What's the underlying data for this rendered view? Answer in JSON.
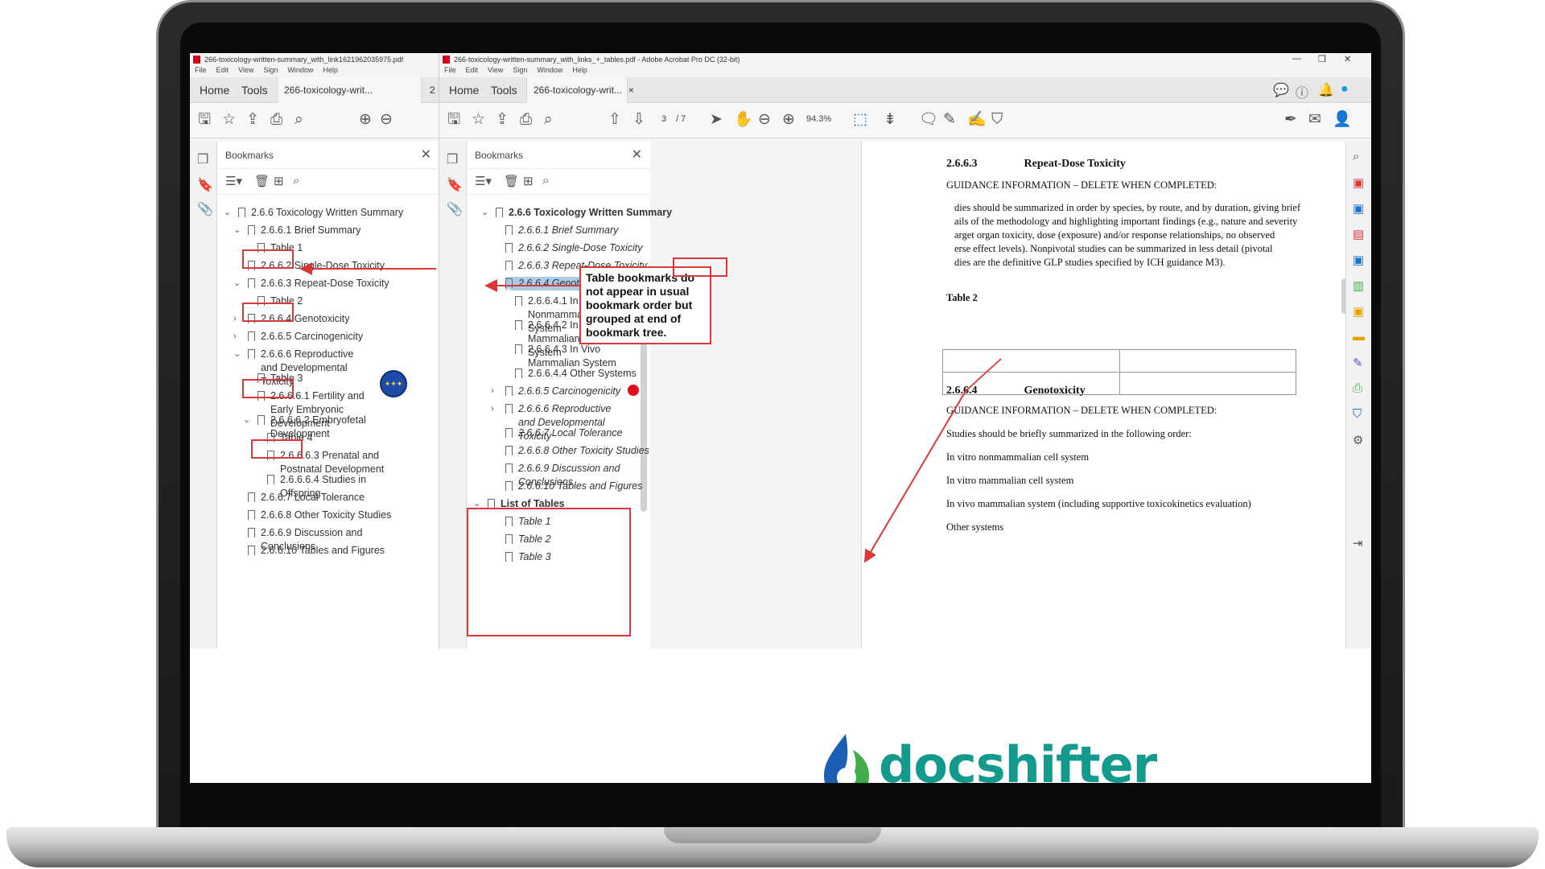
{
  "left_window": {
    "title": "266-toxicology-written-summary_with_link1621962035975.pdf",
    "menu": [
      "File",
      "Edit",
      "View",
      "Sign",
      "Window",
      "Help"
    ],
    "tabs": {
      "home": "Home",
      "tools": "Tools",
      "doc": "266-toxicology-writ...",
      "overflow": "2"
    },
    "panel_title": "Bookmarks",
    "bookmarks": [
      "2.6.6 Toxicology Written Summary",
      "2.6.6.1 Brief Summary",
      "Table 1",
      "2.6.6.2 Single-Dose Toxicity",
      "2.6.6.3 Repeat-Dose Toxicity",
      "Table 2",
      "2.6.6.4 Genotoxicity",
      "2.6.6.5 Carcinogenicity",
      "2.6.6.6 Reproductive and Developmental Toxicity",
      "Table 3",
      "2.6.6.6.1 Fertility and Early Embryonic Development",
      "2.6.6.6.2 Embryofetal Development",
      "Table 4",
      "2.6.6.6.3 Prenatal and Postnatal Development",
      "2.6.6.6.4 Studies in Offspring",
      "2.6.6.7 Local Tolerance",
      "2.6.6.8 Other Toxicity Studies",
      "2.6.6.9 Discussion and Conclusions",
      "2.6.6.10 Tables and Figures"
    ]
  },
  "right_window": {
    "title": "266-toxicology-written-summary_with_links_+_tables.pdf - Adobe Acrobat Pro DC (32-bit)",
    "menu": [
      "File",
      "Edit",
      "View",
      "Sign",
      "Window",
      "Help"
    ],
    "tabs": {
      "home": "Home",
      "tools": "Tools",
      "doc": "266-toxicology-writ...",
      "close": "×"
    },
    "page_current": "3",
    "page_total": "/ 7",
    "zoom": "94.3%",
    "panel_title": "Bookmarks",
    "bookmarks": [
      "2.6.6 Toxicology Written Summary",
      "2.6.6.1 Brief Summary",
      "2.6.6.2 Single-Dose Toxicity",
      "2.6.6.3 Repeat-Dose Toxicity",
      "2.6.6.4 Genotoxicity",
      "2.6.6.4.1 In Vitro Nonmammalian Cell System",
      "2.6.6.4.2 In Vitro Mammalian Cell System",
      "2.6.6.4.3 In Vivo Mammalian System",
      "2.6.6.4.4 Other Systems",
      "2.6.6.5 Carcinogenicity",
      "2.6.6.6 Reproductive and Developmental Toxicity",
      "2.6.6.7 Local Tolerance",
      "2.6.6.8 Other Toxicity Studies",
      "2.6.6.9 Discussion and Conclusions",
      "2.6.6.10 Tables and Figures",
      "List of Tables",
      "Table 1",
      "Table 2",
      "Table 3"
    ]
  },
  "callout_text": "Table bookmarks do not appear in usual bookmark order but grouped at end of bookmark tree.",
  "document": {
    "sec1_num": "2.6.6.3",
    "sec1_title": "Repeat-Dose Toxicity",
    "guidance": "GUIDANCE INFORMATION – DELETE WHEN COMPLETED:",
    "p1_lines": [
      "dies should be summarized in order by species, by route, and by duration, giving brief",
      "ails of the methodology and highlighting important findings (e.g., nature and severity",
      "arget organ toxicity, dose (exposure) and/or response relationships, no observed",
      "erse effect levels). Nonpivotal studies can be summarized in less detail (pivotal",
      "dies are the definitive GLP studies specified by ICH guidance M3)."
    ],
    "table_label": "Table 2",
    "sec2_num": "2.6.6.4",
    "sec2_title": "Genotoxicity",
    "p2": "Studies should be briefly summarized in the following order:",
    "list": [
      "In vitro nonmammalian cell system",
      "In vitro mammalian cell system",
      "In vivo mammalian system (including supportive toxicokinetics evaluation)",
      "Other systems"
    ]
  },
  "logo": {
    "text": "docshifter"
  },
  "colors": {
    "accent_red": "#d9383a",
    "logo_teal": "#149a8c",
    "logo_blue": "#1a5fb4",
    "logo_green": "#3fae49"
  }
}
